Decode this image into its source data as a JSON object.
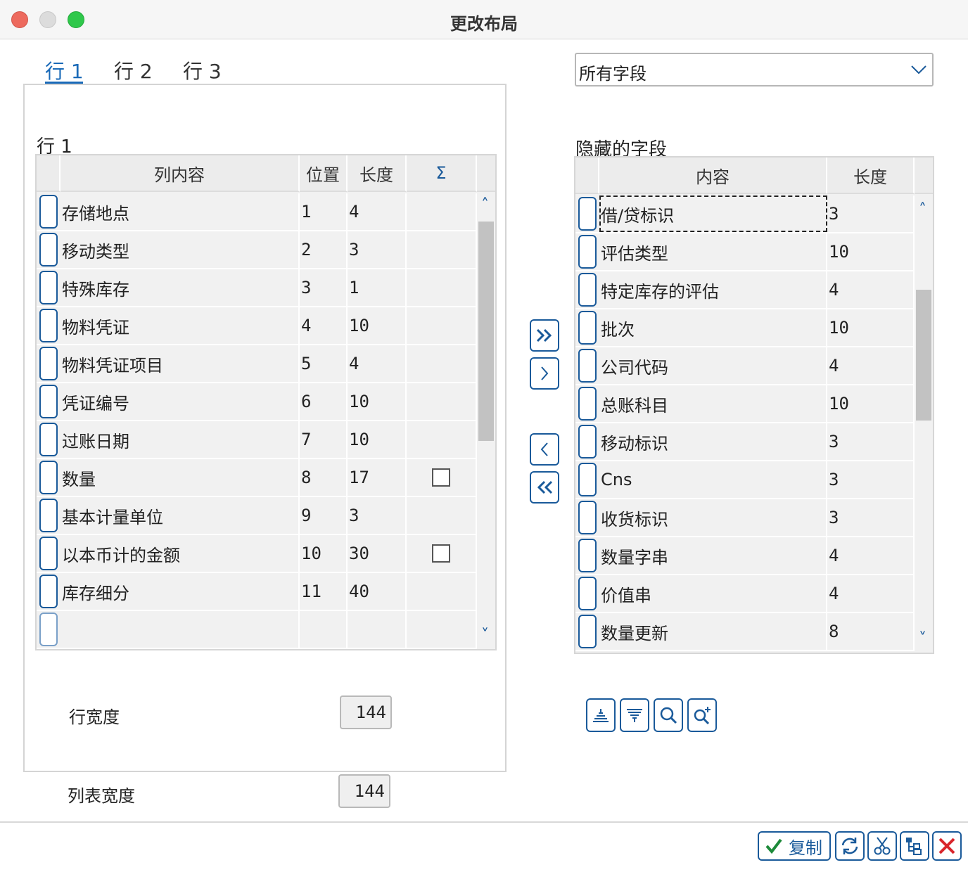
{
  "window": {
    "title": "更改布局"
  },
  "tabs": [
    {
      "label": "行 1",
      "active": true
    },
    {
      "label": "行 2",
      "active": false
    },
    {
      "label": "行 3",
      "active": false
    }
  ],
  "left": {
    "section_title": "行 1",
    "headers": {
      "content": "列内容",
      "position": "位置",
      "length": "长度",
      "sum": "Σ"
    },
    "rows": [
      {
        "content": "存储地点",
        "position": "1",
        "length": "4",
        "sum_checkbox": false
      },
      {
        "content": "移动类型",
        "position": "2",
        "length": "3",
        "sum_checkbox": false
      },
      {
        "content": "特殊库存",
        "position": "3",
        "length": "1",
        "sum_checkbox": false
      },
      {
        "content": "物料凭证",
        "position": "4",
        "length": "10",
        "sum_checkbox": false
      },
      {
        "content": "物料凭证项目",
        "position": "5",
        "length": "4",
        "sum_checkbox": false
      },
      {
        "content": "凭证编号",
        "position": "6",
        "length": "10",
        "sum_checkbox": false
      },
      {
        "content": "过账日期",
        "position": "7",
        "length": "10",
        "sum_checkbox": false
      },
      {
        "content": "数量",
        "position": "8",
        "length": "17",
        "sum_checkbox": true
      },
      {
        "content": "基本计量单位",
        "position": "9",
        "length": "3",
        "sum_checkbox": false
      },
      {
        "content": "以本币计的金额",
        "position": "10",
        "length": "30",
        "sum_checkbox": true
      },
      {
        "content": "库存细分",
        "position": "11",
        "length": "40",
        "sum_checkbox": false
      },
      {
        "content": "",
        "position": "",
        "length": "",
        "sum_checkbox": false
      }
    ],
    "row_width_label": "行宽度",
    "row_width_value": "144",
    "list_width_label": "列表宽度",
    "list_width_value": "144"
  },
  "right": {
    "dropdown_value": "所有字段",
    "section_title": "隐藏的字段",
    "headers": {
      "content": "内容",
      "length": "长度"
    },
    "rows": [
      {
        "content": "借/贷标识",
        "length": "3"
      },
      {
        "content": "评估类型",
        "length": "10"
      },
      {
        "content": "特定库存的评估",
        "length": "4"
      },
      {
        "content": "批次",
        "length": "10"
      },
      {
        "content": "公司代码",
        "length": "4"
      },
      {
        "content": "总账科目",
        "length": "10"
      },
      {
        "content": "移动标识",
        "length": "3"
      },
      {
        "content": "Cns",
        "length": "3"
      },
      {
        "content": "收货标识",
        "length": "3"
      },
      {
        "content": "数量字串",
        "length": "4"
      },
      {
        "content": "价值串",
        "length": "4"
      },
      {
        "content": "数量更新",
        "length": "8"
      }
    ]
  },
  "footer": {
    "copy_label": "复制"
  },
  "colors": {
    "accent": "#1a5a9a",
    "tab_active": "#1a6ab8",
    "cancel": "#d9262c",
    "ok": "#1d8a3a"
  }
}
